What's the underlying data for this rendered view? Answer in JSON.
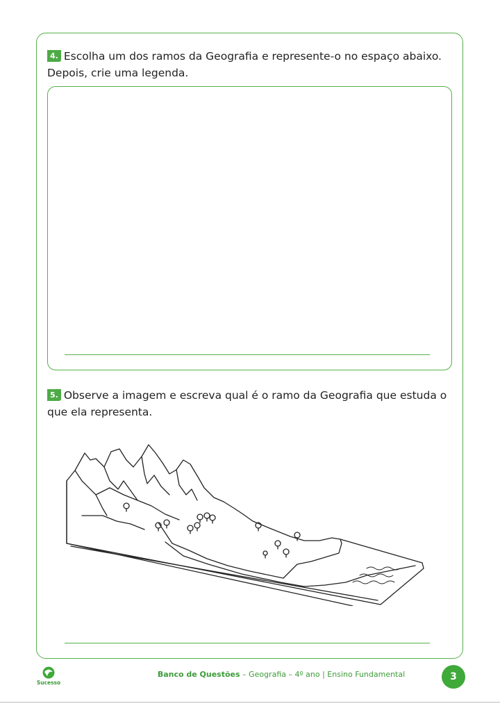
{
  "question4": {
    "number": "4.",
    "text": "Escolha um dos ramos da Geografia e represente-o no espaço abaixo. Depois, crie uma legenda."
  },
  "question5": {
    "number": "5.",
    "text": "Observe a imagem e escreva qual é o ramo da Geografia que estuda o que ela representa."
  },
  "illustration": {
    "subject": "landscape-block-diagram-mountains-to-sea"
  },
  "footer": {
    "logo_text": "Sucesso",
    "title_bold": "Banco de Questões",
    "title_rest": " – Geografia – 4º ano | Ensino Fundamental",
    "page_number": "3"
  },
  "colors": {
    "accent_green": "#4dab46",
    "border_green": "#55b04a"
  }
}
